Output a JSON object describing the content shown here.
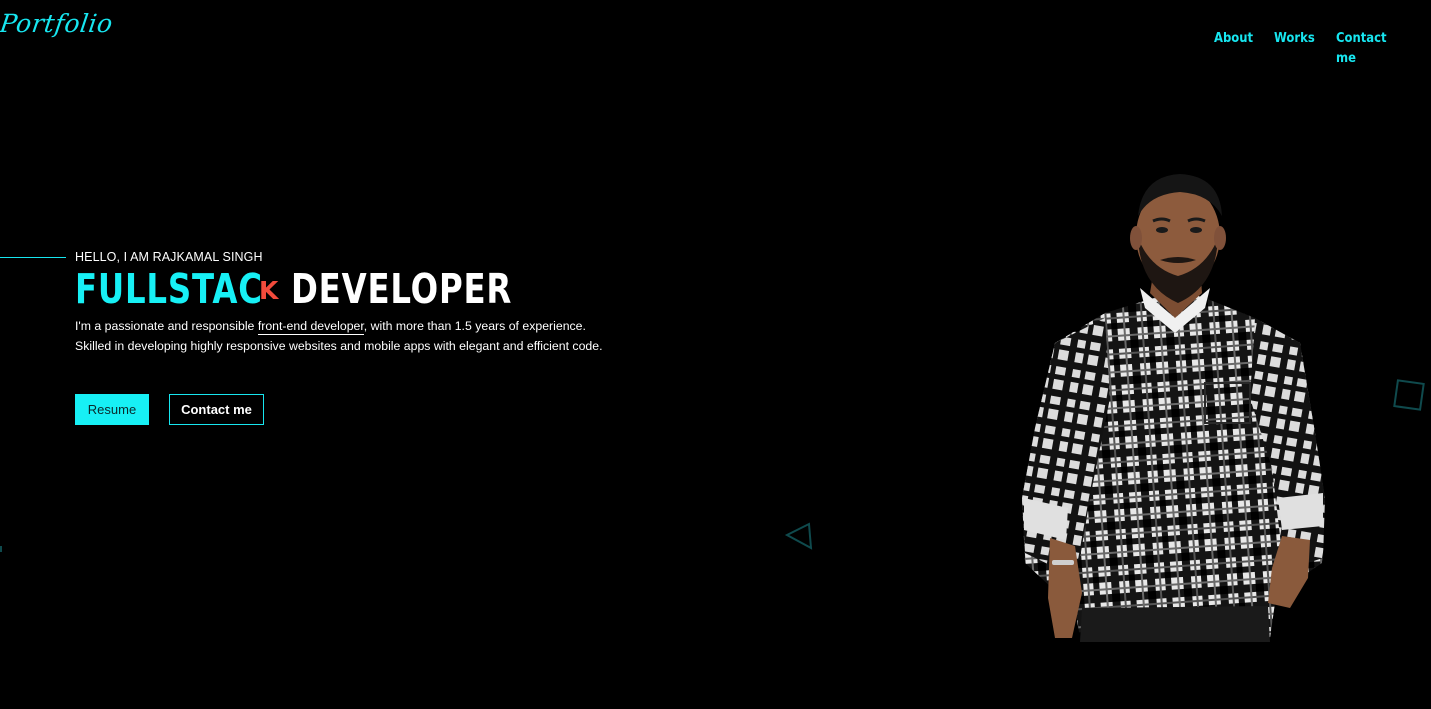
{
  "header": {
    "logo": "Portfolio",
    "nav": {
      "about": "About",
      "works": "Works",
      "contact": "Contact me"
    }
  },
  "hero": {
    "greeting": "HELLO, I AM RAJKAMAL SINGH",
    "headline_part1": "FULLSTAC",
    "headline_k": "K",
    "headline_part2": "DEVELOPER",
    "desc_line1_before": "I'm a passionate and responsible ",
    "desc_line1_highlight": "front-end developer",
    "desc_line1_after": ", with more than 1.5 years of experience.",
    "desc_line2": "Skilled in developing highly responsive websites and mobile apps with elegant and efficient code.",
    "resume_button": "Resume",
    "contact_button": "Contact me"
  },
  "colors": {
    "accent": "#17e6f0",
    "k_accent": "#f24b3c",
    "background": "#000000",
    "text": "#ffffff"
  },
  "icons": {
    "triangle": "triangle-outline-icon",
    "square": "square-outline-icon"
  }
}
